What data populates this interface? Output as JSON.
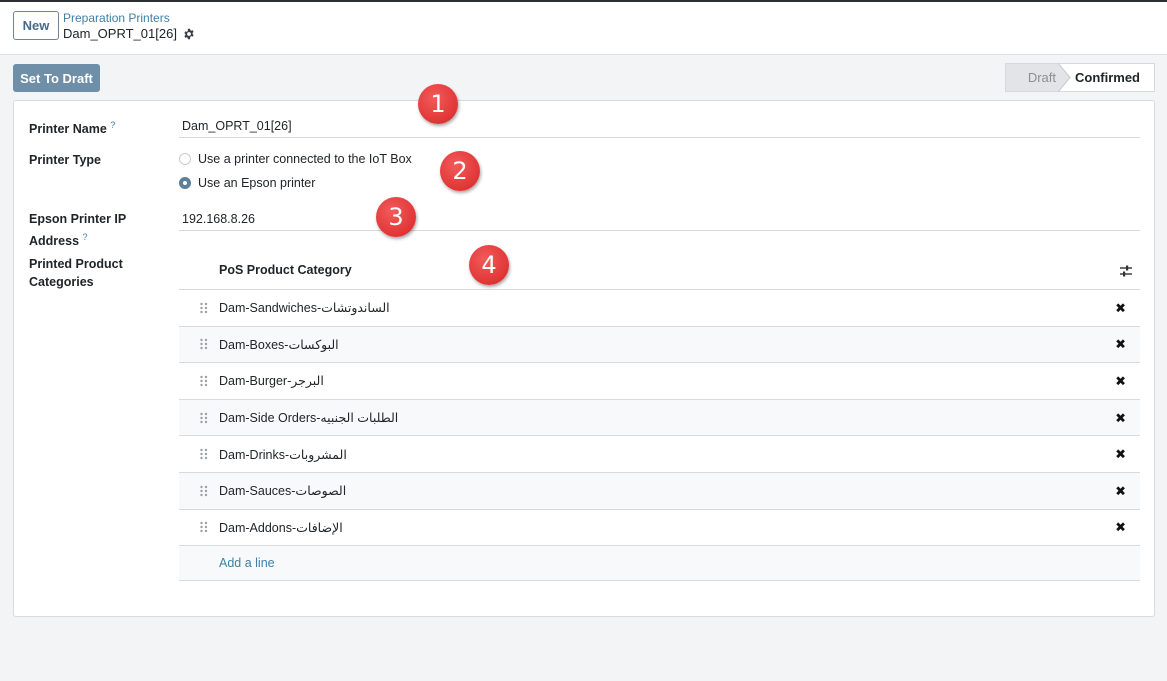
{
  "header": {
    "new_label": "New",
    "breadcrumb_parent": "Preparation Printers",
    "record_name": "Dam_OPRT_01[26]"
  },
  "actions": {
    "set_to_draft": "Set To Draft"
  },
  "status": {
    "draft": "Draft",
    "confirmed": "Confirmed",
    "active": "Confirmed"
  },
  "form": {
    "printer_name_label": "Printer Name",
    "help_marker": "?",
    "printer_name_value": "Dam_OPRT_01[26]",
    "printer_type_label": "Printer Type",
    "printer_type_options": [
      {
        "label": "Use a printer connected to the IoT Box",
        "selected": false
      },
      {
        "label": "Use an Epson printer",
        "selected": true
      }
    ],
    "epson_ip_label_line1": "Epson Printer IP",
    "epson_ip_label_line2": "Address",
    "epson_ip_value": "192.168.8.26",
    "categories_label_line1": "Printed Product",
    "categories_label_line2": "Categories"
  },
  "categories_table": {
    "column_header": "PoS Product Category",
    "rows": [
      "Dam-Sandwiches-الساندوتشات",
      "Dam-Boxes-البوكسات",
      "Dam-Burger-البرجر",
      "Dam-Side Orders-الطلبات الجنبيه",
      "Dam-Drinks-المشروبات",
      "Dam-Sauces-الصوصات",
      "Dam-Addons-الإضافات"
    ],
    "add_line_label": "Add a line",
    "delete_glyph": "✖"
  },
  "callouts": [
    "1",
    "2",
    "3",
    "4"
  ],
  "colors": {
    "accent": "#6f8ea7",
    "link": "#3f7fa6",
    "callout": "#d92424"
  }
}
